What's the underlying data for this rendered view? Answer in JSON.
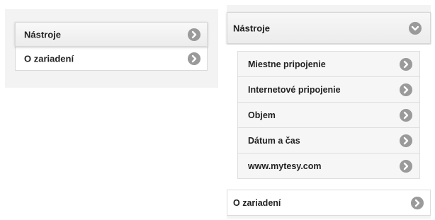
{
  "left_menu": {
    "items": [
      {
        "label": "Nástroje",
        "icon": "chevron-right-icon",
        "active": true
      },
      {
        "label": "O zariadení",
        "icon": "chevron-right-icon",
        "active": false
      }
    ]
  },
  "right_menu": {
    "header": {
      "label": "Nástroje",
      "icon": "chevron-down-icon",
      "expanded": true
    },
    "submenu": [
      {
        "label": "Miestne pripojenie",
        "icon": "chevron-right-icon"
      },
      {
        "label": "Internetové pripojenie",
        "icon": "chevron-right-icon"
      },
      {
        "label": "Objem",
        "icon": "chevron-right-icon"
      },
      {
        "label": "Dátum a čas",
        "icon": "chevron-right-icon"
      },
      {
        "label": "www.mytesy.com",
        "icon": "chevron-right-icon"
      }
    ],
    "footer": {
      "label": "O zariadení",
      "icon": "chevron-right-icon"
    }
  },
  "colors": {
    "panel_background": "#f3f3f3",
    "icon_circle": "#9a9a9a",
    "text": "#222222"
  }
}
